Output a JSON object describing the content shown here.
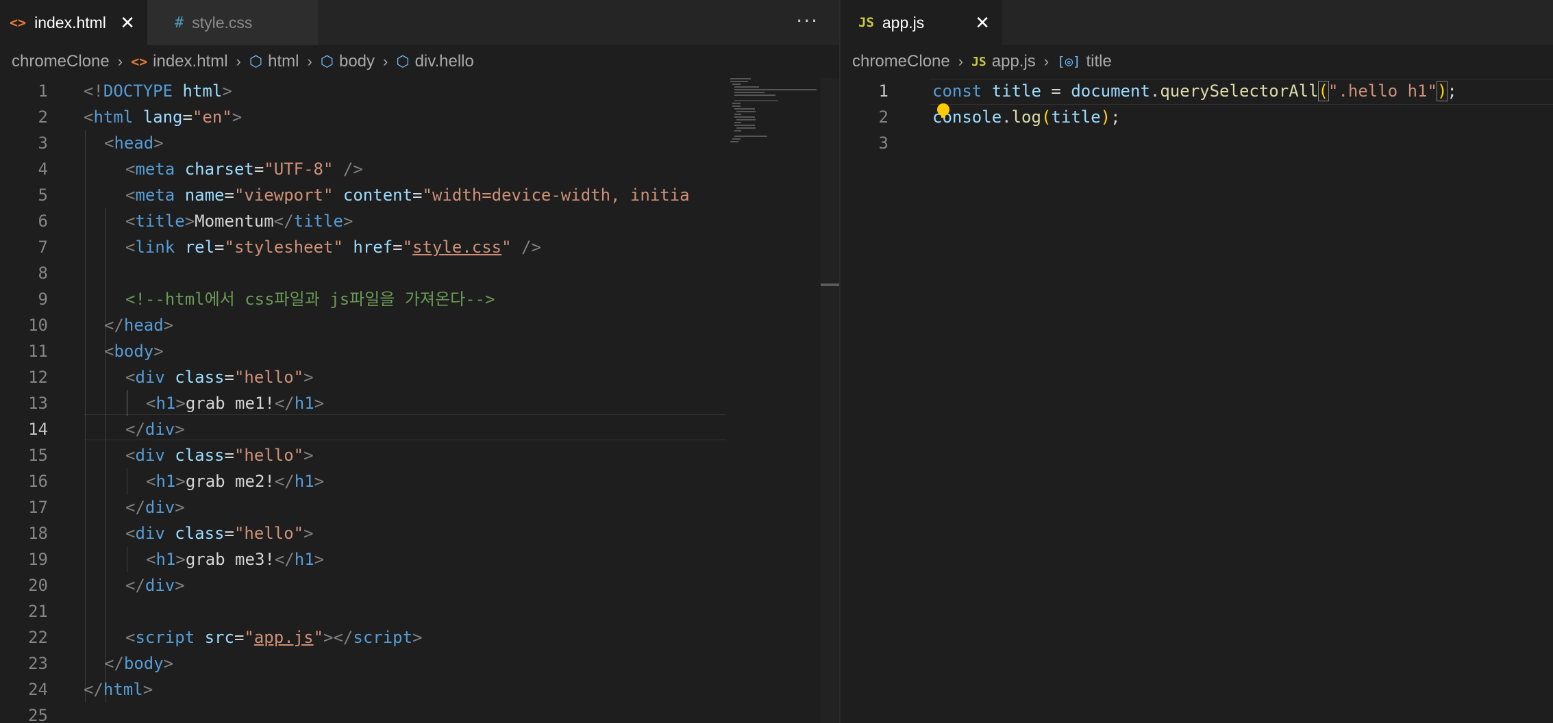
{
  "left_pane": {
    "tabs": [
      {
        "icon": "html-file-icon",
        "label": "index.html",
        "close": "✕",
        "active": true
      },
      {
        "icon": "css-file-icon",
        "label": "style.css",
        "active": false
      }
    ],
    "more_label": "···",
    "breadcrumb": [
      "chromeClone",
      "index.html",
      "html",
      "body",
      "div.hello"
    ],
    "lines": [
      {
        "n": "1"
      },
      {
        "n": "2"
      },
      {
        "n": "3"
      },
      {
        "n": "4"
      },
      {
        "n": "5"
      },
      {
        "n": "6"
      },
      {
        "n": "7"
      },
      {
        "n": "8"
      },
      {
        "n": "9"
      },
      {
        "n": "10"
      },
      {
        "n": "11"
      },
      {
        "n": "12"
      },
      {
        "n": "13"
      },
      {
        "n": "14"
      },
      {
        "n": "15"
      },
      {
        "n": "16"
      },
      {
        "n": "17"
      },
      {
        "n": "18"
      },
      {
        "n": "19"
      },
      {
        "n": "20"
      },
      {
        "n": "21"
      },
      {
        "n": "22"
      },
      {
        "n": "23"
      },
      {
        "n": "24"
      },
      {
        "n": "25"
      }
    ],
    "current_line": "14",
    "code": {
      "l1": {
        "a": "<!",
        "b": "DOCTYPE",
        "c": " html",
        "d": ">"
      },
      "l2": {
        "a": "<",
        "b": "html",
        "c": " lang",
        "d": "=",
        "e": "\"en\"",
        "f": ">"
      },
      "l3": {
        "a": "<",
        "b": "head",
        "c": ">"
      },
      "l4": {
        "a": "<",
        "b": "meta",
        "c": " charset",
        "d": "=",
        "e": "\"UTF-8\"",
        "f": " />"
      },
      "l5": {
        "a": "<",
        "b": "meta",
        "c": " name",
        "d": "=",
        "e": "\"viewport\"",
        "f": " content",
        "g": "=",
        "h": "\"width=device-width, initia"
      },
      "l6": {
        "a": "<",
        "b": "title",
        "c": ">",
        "d": "Momentum",
        "e": "</",
        "f": "title",
        "g": ">"
      },
      "l7": {
        "a": "<",
        "b": "link",
        "c": " rel",
        "d": "=",
        "e": "\"stylesheet\"",
        "f": " href",
        "g": "=",
        "h": "\"",
        "i": "style.css",
        "j": "\"",
        "k": " />"
      },
      "l9": {
        "a": "<!--html에서 css파일과 js파일을 가져온다-->"
      },
      "l10": {
        "a": "</",
        "b": "head",
        "c": ">"
      },
      "l11": {
        "a": "<",
        "b": "body",
        "c": ">"
      },
      "l12": {
        "a": "<",
        "b": "div",
        "c": " class",
        "d": "=",
        "e": "\"hello\"",
        "f": ">"
      },
      "l13": {
        "a": "<",
        "b": "h1",
        "c": ">",
        "d": "grab me1!",
        "e": "</",
        "f": "h1",
        "g": ">"
      },
      "l14": {
        "a": "</",
        "b": "div",
        "c": ">"
      },
      "l15": {
        "a": "<",
        "b": "div",
        "c": " class",
        "d": "=",
        "e": "\"hello\"",
        "f": ">"
      },
      "l16": {
        "a": "<",
        "b": "h1",
        "c": ">",
        "d": "grab me2!",
        "e": "</",
        "f": "h1",
        "g": ">"
      },
      "l17": {
        "a": "</",
        "b": "div",
        "c": ">"
      },
      "l18": {
        "a": "<",
        "b": "div",
        "c": " class",
        "d": "=",
        "e": "\"hello\"",
        "f": ">"
      },
      "l19": {
        "a": "<",
        "b": "h1",
        "c": ">",
        "d": "grab me3!",
        "e": "</",
        "f": "h1",
        "g": ">"
      },
      "l20": {
        "a": "</",
        "b": "div",
        "c": ">"
      },
      "l22": {
        "a": "<",
        "b": "script",
        "c": " src",
        "d": "=",
        "e": "\"",
        "f": "app.js",
        "g": "\"",
        "h": "></",
        "i": "script",
        "j": ">"
      },
      "l23": {
        "a": "</",
        "b": "body",
        "c": ">"
      },
      "l24": {
        "a": "</",
        "b": "html",
        "c": ">"
      }
    }
  },
  "right_pane": {
    "tabs": [
      {
        "icon": "js-file-icon",
        "label": "app.js",
        "close": "✕",
        "active": true
      }
    ],
    "breadcrumb": [
      "chromeClone",
      "app.js",
      "title"
    ],
    "lines": [
      {
        "n": "1"
      },
      {
        "n": "2"
      },
      {
        "n": "3"
      }
    ],
    "current_line": "1",
    "code": {
      "l1": {
        "a": "const",
        "b": " title",
        "c": " = ",
        "d": "document",
        "e": ".",
        "f": "querySelectorAll",
        "g": "(",
        "h": "\".hello h1\"",
        "i": ")",
        "j": ";"
      },
      "l2": {
        "a": "console",
        "b": ".",
        "c": "log",
        "d": "(",
        "e": "title",
        "f": ")",
        "g": ";"
      }
    }
  },
  "colors": {
    "background": "#1e1e1e",
    "tag": "#569cd6",
    "attribute": "#9cdcfe",
    "string": "#ce9178",
    "comment": "#6a9955",
    "function": "#dcdcaa",
    "bracket": "#ffd700",
    "lightbulb": "#ffcc00"
  }
}
